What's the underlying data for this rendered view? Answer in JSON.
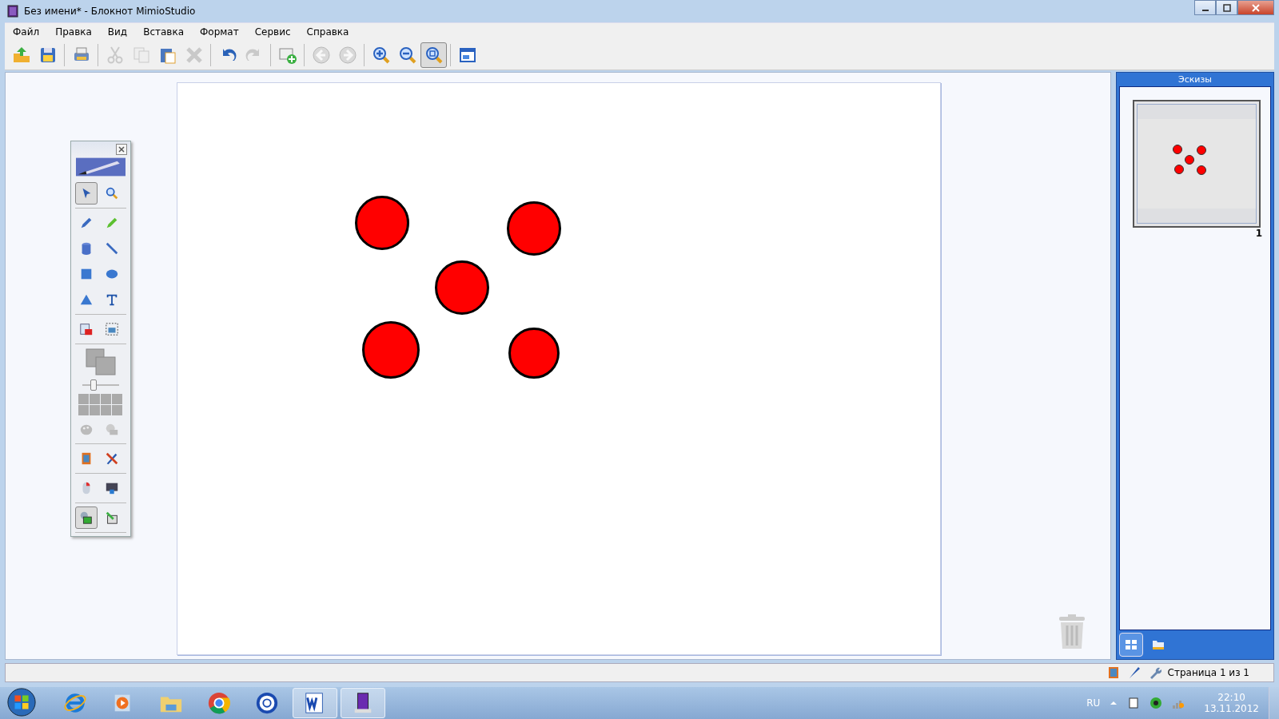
{
  "window": {
    "title": "Без имени* - Блокнот MimioStudio"
  },
  "menu": [
    {
      "label": "Файл"
    },
    {
      "label": "Правка"
    },
    {
      "label": "Вид"
    },
    {
      "label": "Вставка"
    },
    {
      "label": "Формат"
    },
    {
      "label": "Сервис"
    },
    {
      "label": "Справка"
    }
  ],
  "toolbar": [
    [
      {
        "kind": "open",
        "disabled": false,
        "selected": false
      },
      {
        "kind": "save",
        "disabled": false,
        "selected": false
      }
    ],
    [
      {
        "kind": "print",
        "disabled": false,
        "selected": false
      }
    ],
    [
      {
        "kind": "cut",
        "disabled": true,
        "selected": false
      },
      {
        "kind": "copy",
        "disabled": true,
        "selected": false
      },
      {
        "kind": "paste",
        "disabled": false,
        "selected": false
      },
      {
        "kind": "delete",
        "disabled": true,
        "selected": false
      }
    ],
    [
      {
        "kind": "undo",
        "disabled": false,
        "selected": false
      },
      {
        "kind": "redo",
        "disabled": true,
        "selected": false
      }
    ],
    [
      {
        "kind": "newpage",
        "disabled": false,
        "selected": false
      }
    ],
    [
      {
        "kind": "back",
        "disabled": true,
        "selected": false
      },
      {
        "kind": "forward",
        "disabled": true,
        "selected": false
      }
    ],
    [
      {
        "kind": "zoomin",
        "disabled": false,
        "selected": false
      },
      {
        "kind": "zoomout",
        "disabled": false,
        "selected": false
      },
      {
        "kind": "zoomfit",
        "disabled": false,
        "selected": true
      }
    ],
    [
      {
        "kind": "window",
        "disabled": false,
        "selected": false
      }
    ]
  ],
  "canvas": {
    "shapes": [
      {
        "kind": "circle",
        "color": "#ff0000"
      },
      {
        "kind": "circle",
        "color": "#ff0000"
      },
      {
        "kind": "circle",
        "color": "#ff0000"
      },
      {
        "kind": "circle",
        "color": "#ff0000"
      },
      {
        "kind": "circle",
        "color": "#ff0000"
      }
    ]
  },
  "toolbox": {
    "groups": [
      [
        {
          "kind": "select",
          "selected": true
        },
        {
          "kind": "zoom",
          "selected": false
        }
      ],
      [
        {
          "kind": "pen",
          "selected": false
        },
        {
          "kind": "highlighter",
          "selected": false
        },
        {
          "kind": "fill",
          "selected": false
        },
        {
          "kind": "line",
          "selected": false
        },
        {
          "kind": "rect",
          "selected": false
        },
        {
          "kind": "ellipse",
          "selected": false
        },
        {
          "kind": "triangle",
          "selected": false
        },
        {
          "kind": "text",
          "selected": false
        }
      ],
      [
        {
          "kind": "import",
          "selected": false
        },
        {
          "kind": "capture",
          "selected": false
        }
      ]
    ],
    "slider": {
      "level": 0.3
    },
    "groups_after": [
      [
        {
          "kind": "gallery",
          "selected": false
        },
        {
          "kind": "tools",
          "selected": false
        }
      ],
      [
        {
          "kind": "mouse",
          "selected": false
        },
        {
          "kind": "screen",
          "selected": false
        }
      ],
      [
        {
          "kind": "shapes",
          "selected": true
        },
        {
          "kind": "export",
          "selected": false
        }
      ]
    ]
  },
  "thumbnails": {
    "header": "Эскизы",
    "pages": [
      {
        "number": "1",
        "selected": true
      }
    ],
    "tabs": [
      {
        "kind": "thumbnails",
        "selected": true
      },
      {
        "kind": "folder",
        "selected": false
      }
    ]
  },
  "status_bar": {
    "page": "Страница 1 из 1"
  },
  "taskbar": {
    "apps": [
      {
        "kind": "ie",
        "running": false
      },
      {
        "kind": "media",
        "running": false
      },
      {
        "kind": "explorer",
        "running": false
      },
      {
        "kind": "chrome",
        "running": false
      },
      {
        "kind": "disc",
        "running": false
      },
      {
        "kind": "word",
        "running": true
      },
      {
        "kind": "mimio",
        "running": true
      }
    ],
    "language": "RU",
    "time": "22:10",
    "date": "13.11.2012"
  }
}
